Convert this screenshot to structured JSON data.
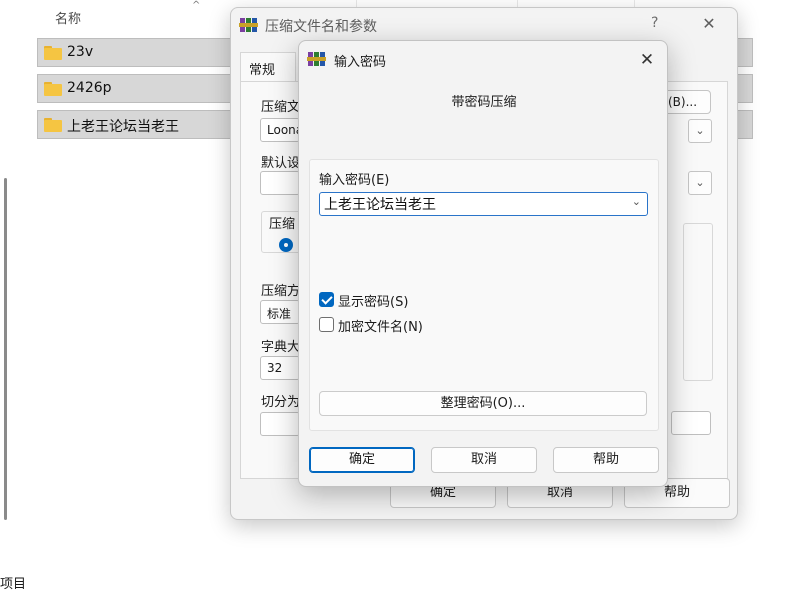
{
  "explorer": {
    "column_name": "名称",
    "status": "项目",
    "files": [
      {
        "name": "23v"
      },
      {
        "name": "2426p"
      },
      {
        "name": "上老王论坛当老王"
      }
    ]
  },
  "archive_dialog": {
    "title": "压缩文件名和参数",
    "help_label": "?",
    "close_label": "✕",
    "tab_general": "常规",
    "archive_name_label": "压缩文",
    "archive_name_value": "Loona.",
    "browse_label": "(B)...",
    "default_profile_label": "默认设",
    "archive_format_label": "压缩",
    "compression_method_label": "压缩方",
    "compression_method_value": "标准",
    "dictionary_label": "字典大",
    "dictionary_value": "32",
    "split_label": "切分为",
    "ok_label": "确定",
    "cancel_label": "取消",
    "help_button_label": "帮助"
  },
  "password_dialog": {
    "title": "输入密码",
    "close_label": "✕",
    "subtitle": "带密码压缩",
    "password_label": "输入密码(E)",
    "password_value": "上老王论坛当老王",
    "show_password_label": "显示密码(S)",
    "show_password_checked": true,
    "encrypt_filenames_label": "加密文件名(N)",
    "encrypt_filenames_checked": false,
    "organize_label": "整理密码(O)...",
    "ok_label": "确定",
    "cancel_label": "取消",
    "help_label": "帮助"
  },
  "icons": {
    "app": "winrar-books-icon",
    "folder": "folder-icon",
    "chevron": "chevron-down-icon",
    "close": "close-icon"
  },
  "colors": {
    "accent": "#0067c0",
    "folder": "#f5c542",
    "selected_row": "#d7d7d7"
  }
}
